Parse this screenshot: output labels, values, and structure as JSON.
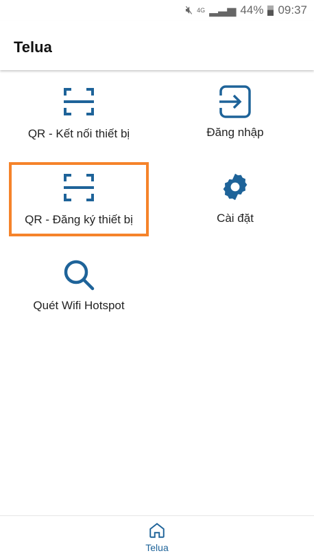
{
  "status_bar": {
    "battery": "44%",
    "time": "09:37",
    "network": "4G"
  },
  "header": {
    "title": "Telua"
  },
  "menu": [
    {
      "label": "QR - Kết nối thiết bị",
      "icon": "qr-scan-icon"
    },
    {
      "label": "Đăng nhập",
      "icon": "login-icon"
    },
    {
      "label": "QR - Đăng ký thiết bị",
      "icon": "qr-scan-icon",
      "highlighted": true
    },
    {
      "label": "Cài đặt",
      "icon": "gear-icon"
    },
    {
      "label": "Quét Wifi Hotspot",
      "icon": "search-icon"
    }
  ],
  "bottom_nav": {
    "label": "Telua",
    "icon": "home-icon"
  },
  "colors": {
    "accent": "#1e6399",
    "highlight": "#f5832a"
  }
}
